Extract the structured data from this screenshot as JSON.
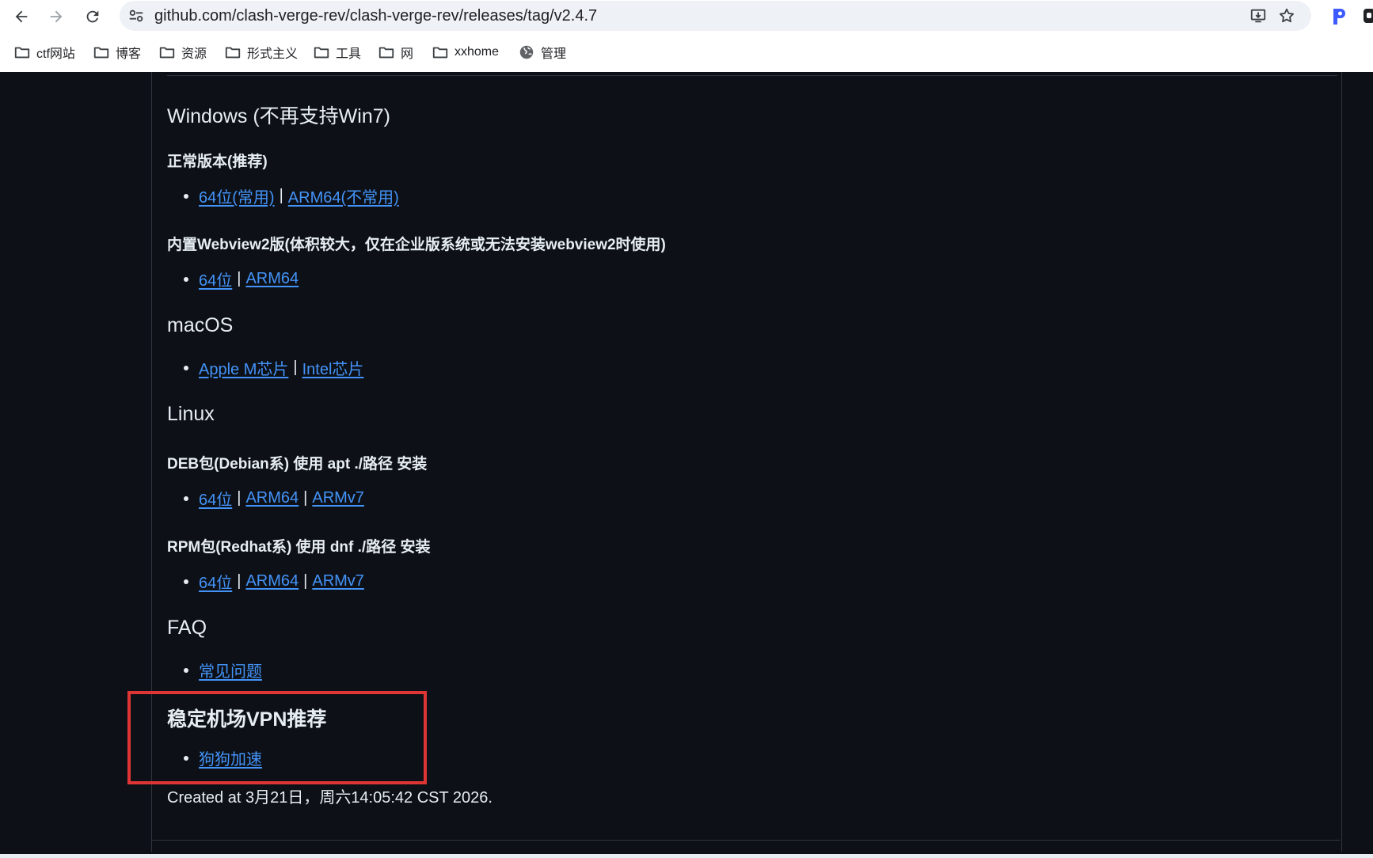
{
  "browser": {
    "url": "github.com/clash-verge-rev/clash-verge-rev/releases/tag/v2.4.7",
    "bookmarks": [
      {
        "label": "ctf网站",
        "icon": "folder-icon"
      },
      {
        "label": "博客",
        "icon": "folder-icon"
      },
      {
        "label": "资源",
        "icon": "folder-icon"
      },
      {
        "label": "形式主义",
        "icon": "folder-icon"
      },
      {
        "label": "工具",
        "icon": "folder-icon"
      },
      {
        "label": "网",
        "icon": "folder-icon"
      },
      {
        "label": "xxhome",
        "icon": "folder-icon"
      },
      {
        "label": "管理",
        "icon": "globe-icon"
      }
    ]
  },
  "content": {
    "windows": {
      "heading": "Windows (不再支持Win7)",
      "normal": {
        "heading": "正常版本(推荐)",
        "links": [
          "64位(常用)",
          "ARM64(不常用)"
        ]
      },
      "webview": {
        "heading": "内置Webview2版(体积较大，仅在企业版系统或无法安装webview2时使用)",
        "links": [
          "64位",
          "ARM64"
        ]
      }
    },
    "macos": {
      "heading": "macOS",
      "links": [
        "Apple M芯片",
        "Intel芯片"
      ]
    },
    "linux": {
      "heading": "Linux",
      "deb": {
        "heading": "DEB包(Debian系) 使用 apt ./路径 安装",
        "links": [
          "64位",
          "ARM64",
          "ARMv7"
        ]
      },
      "rpm": {
        "heading": "RPM包(Redhat系) 使用 dnf ./路径 安装",
        "links": [
          "64位",
          "ARM64",
          "ARMv7"
        ]
      }
    },
    "faq": {
      "heading": "FAQ",
      "links": [
        "常见问题"
      ]
    },
    "vpn": {
      "heading": "稳定机场VPN推荐",
      "links": [
        "狗狗加速"
      ]
    },
    "created": "Created at 3月21日，周六14:05:42 CST 2026.",
    "separator": "|"
  },
  "colors": {
    "background": "#0d1117",
    "text": "#e6edf3",
    "link": "#4493f8",
    "highlight_border": "#e03535"
  }
}
